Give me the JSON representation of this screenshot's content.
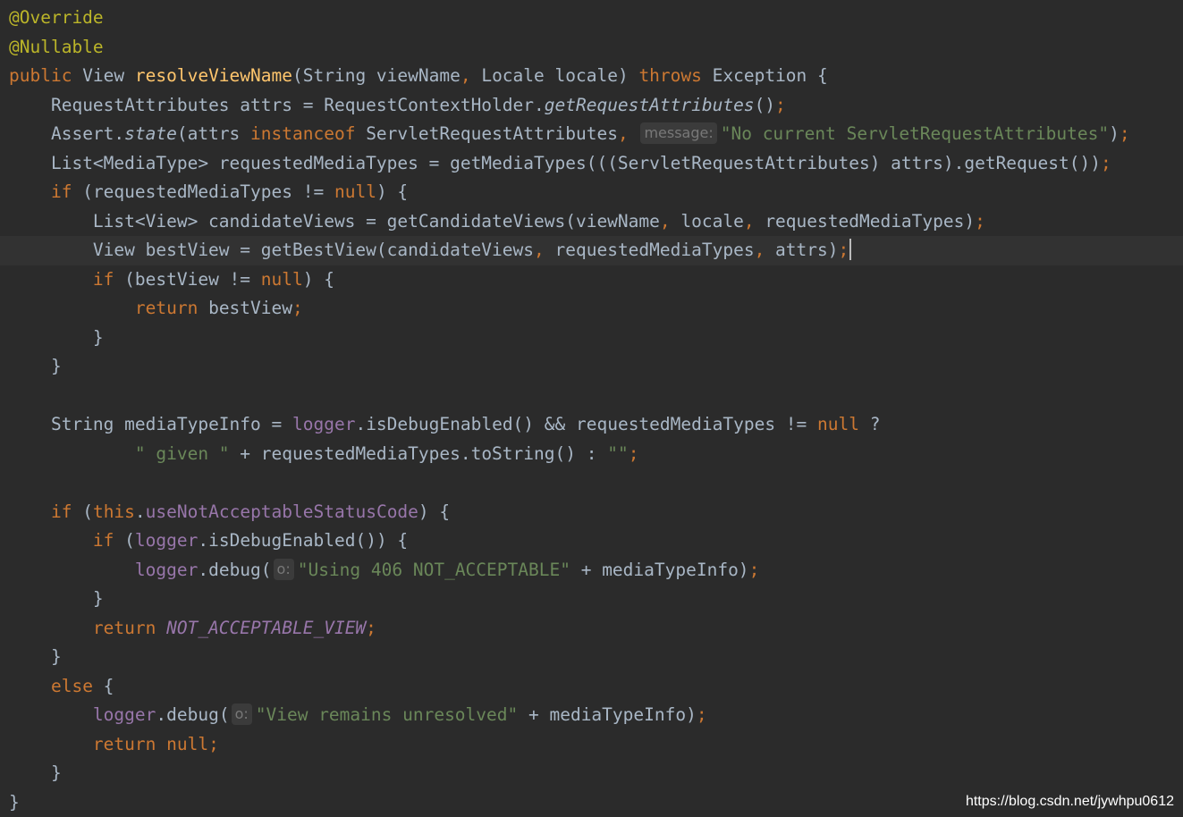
{
  "colors": {
    "background": "#2b2b2b",
    "current_line": "#323232",
    "keyword": "#cc7832",
    "annotation": "#bbb529",
    "method_declaration": "#ffc66d",
    "plain": "#a9b7c6",
    "string": "#6a8759",
    "field": "#9876aa",
    "hint": "#787878"
  },
  "code_lines": [
    {
      "indent": "",
      "tokens": [
        {
          "t": "@Override",
          "k": "annotation"
        }
      ]
    },
    {
      "indent": "",
      "tokens": [
        {
          "t": "@Nullable",
          "k": "annotation"
        }
      ]
    },
    {
      "indent": "",
      "tokens": [
        {
          "t": "public ",
          "k": "keyword"
        },
        {
          "t": "View ",
          "k": "plain"
        },
        {
          "t": "resolveViewName",
          "k": "method-decl"
        },
        {
          "t": "(String viewName",
          "k": "plain"
        },
        {
          "t": ", ",
          "k": "punct"
        },
        {
          "t": "Locale locale) ",
          "k": "plain"
        },
        {
          "t": "throws ",
          "k": "keyword"
        },
        {
          "t": "Exception {",
          "k": "plain"
        }
      ]
    },
    {
      "indent": "    ",
      "tokens": [
        {
          "t": "RequestAttributes attrs = RequestContextHolder.",
          "k": "plain"
        },
        {
          "t": "getRequestAttributes",
          "k": "static-call"
        },
        {
          "t": "()",
          "k": "plain"
        },
        {
          "t": ";",
          "k": "punct"
        }
      ]
    },
    {
      "indent": "    ",
      "tokens": [
        {
          "t": "Assert.",
          "k": "plain"
        },
        {
          "t": "state",
          "k": "static-call"
        },
        {
          "t": "(attrs ",
          "k": "plain"
        },
        {
          "t": "instanceof ",
          "k": "keyword"
        },
        {
          "t": "ServletRequestAttributes",
          "k": "plain"
        },
        {
          "t": ", ",
          "k": "punct"
        },
        {
          "t": "message:",
          "k": "hint"
        },
        {
          "t": "\"No current ServletRequestAttributes\"",
          "k": "string"
        },
        {
          "t": ")",
          "k": "plain"
        },
        {
          "t": ";",
          "k": "punct"
        }
      ]
    },
    {
      "indent": "    ",
      "tokens": [
        {
          "t": "List<MediaType> requestedMediaTypes = getMediaTypes(((ServletRequestAttributes) attrs).getRequest())",
          "k": "plain"
        },
        {
          "t": ";",
          "k": "punct"
        }
      ]
    },
    {
      "indent": "    ",
      "tokens": [
        {
          "t": "if ",
          "k": "keyword"
        },
        {
          "t": "(requestedMediaTypes != ",
          "k": "plain"
        },
        {
          "t": "null",
          "k": "keyword"
        },
        {
          "t": ") {",
          "k": "plain"
        }
      ]
    },
    {
      "indent": "        ",
      "tokens": [
        {
          "t": "List<View> candidateViews = getCandidateViews(viewName",
          "k": "plain"
        },
        {
          "t": ", ",
          "k": "punct"
        },
        {
          "t": "locale",
          "k": "plain"
        },
        {
          "t": ", ",
          "k": "punct"
        },
        {
          "t": "requestedMediaTypes)",
          "k": "plain"
        },
        {
          "t": ";",
          "k": "punct"
        }
      ]
    },
    {
      "indent": "        ",
      "current": true,
      "caret": true,
      "tokens": [
        {
          "t": "View bestView = getBestView(candidateViews",
          "k": "plain"
        },
        {
          "t": ", ",
          "k": "punct"
        },
        {
          "t": "requestedMediaTypes",
          "k": "plain"
        },
        {
          "t": ", ",
          "k": "punct"
        },
        {
          "t": "attrs)",
          "k": "plain"
        },
        {
          "t": ";",
          "k": "punct"
        }
      ]
    },
    {
      "indent": "        ",
      "tokens": [
        {
          "t": "if ",
          "k": "keyword"
        },
        {
          "t": "(bestView != ",
          "k": "plain"
        },
        {
          "t": "null",
          "k": "keyword"
        },
        {
          "t": ") {",
          "k": "plain"
        }
      ]
    },
    {
      "indent": "            ",
      "tokens": [
        {
          "t": "return ",
          "k": "keyword"
        },
        {
          "t": "bestView",
          "k": "plain"
        },
        {
          "t": ";",
          "k": "punct"
        }
      ]
    },
    {
      "indent": "        ",
      "tokens": [
        {
          "t": "}",
          "k": "plain"
        }
      ]
    },
    {
      "indent": "    ",
      "tokens": [
        {
          "t": "}",
          "k": "plain"
        }
      ]
    },
    {
      "indent": "",
      "tokens": []
    },
    {
      "indent": "    ",
      "tokens": [
        {
          "t": "String mediaTypeInfo = ",
          "k": "plain"
        },
        {
          "t": "logger",
          "k": "field"
        },
        {
          "t": ".isDebugEnabled() && requestedMediaTypes != ",
          "k": "plain"
        },
        {
          "t": "null ",
          "k": "keyword"
        },
        {
          "t": "?",
          "k": "plain"
        }
      ]
    },
    {
      "indent": "            ",
      "tokens": [
        {
          "t": "\" given \"",
          "k": "string"
        },
        {
          "t": " + requestedMediaTypes.toString() : ",
          "k": "plain"
        },
        {
          "t": "\"\"",
          "k": "string"
        },
        {
          "t": ";",
          "k": "punct"
        }
      ]
    },
    {
      "indent": "",
      "tokens": []
    },
    {
      "indent": "    ",
      "tokens": [
        {
          "t": "if ",
          "k": "keyword"
        },
        {
          "t": "(",
          "k": "plain"
        },
        {
          "t": "this",
          "k": "keyword"
        },
        {
          "t": ".",
          "k": "plain"
        },
        {
          "t": "useNotAcceptableStatusCode",
          "k": "field"
        },
        {
          "t": ") {",
          "k": "plain"
        }
      ]
    },
    {
      "indent": "        ",
      "tokens": [
        {
          "t": "if ",
          "k": "keyword"
        },
        {
          "t": "(",
          "k": "plain"
        },
        {
          "t": "logger",
          "k": "field"
        },
        {
          "t": ".isDebugEnabled()) {",
          "k": "plain"
        }
      ]
    },
    {
      "indent": "            ",
      "tokens": [
        {
          "t": "logger",
          "k": "field"
        },
        {
          "t": ".debug(",
          "k": "plain"
        },
        {
          "t": "o:",
          "k": "hint"
        },
        {
          "t": "\"Using 406 NOT_ACCEPTABLE\"",
          "k": "string"
        },
        {
          "t": " + mediaTypeInfo)",
          "k": "plain"
        },
        {
          "t": ";",
          "k": "punct"
        }
      ]
    },
    {
      "indent": "        ",
      "tokens": [
        {
          "t": "}",
          "k": "plain"
        }
      ]
    },
    {
      "indent": "        ",
      "tokens": [
        {
          "t": "return ",
          "k": "keyword"
        },
        {
          "t": "NOT_ACCEPTABLE_VIEW",
          "k": "const"
        },
        {
          "t": ";",
          "k": "punct"
        }
      ]
    },
    {
      "indent": "    ",
      "tokens": [
        {
          "t": "}",
          "k": "plain"
        }
      ]
    },
    {
      "indent": "    ",
      "tokens": [
        {
          "t": "else ",
          "k": "keyword"
        },
        {
          "t": "{",
          "k": "plain"
        }
      ]
    },
    {
      "indent": "        ",
      "tokens": [
        {
          "t": "logger",
          "k": "field"
        },
        {
          "t": ".debug(",
          "k": "plain"
        },
        {
          "t": "o:",
          "k": "hint"
        },
        {
          "t": "\"View remains unresolved\"",
          "k": "string"
        },
        {
          "t": " + mediaTypeInfo)",
          "k": "plain"
        },
        {
          "t": ";",
          "k": "punct"
        }
      ]
    },
    {
      "indent": "        ",
      "tokens": [
        {
          "t": "return ",
          "k": "keyword"
        },
        {
          "t": "null",
          "k": "keyword"
        },
        {
          "t": ";",
          "k": "punct"
        }
      ]
    },
    {
      "indent": "    ",
      "tokens": [
        {
          "t": "}",
          "k": "plain"
        }
      ]
    },
    {
      "indent": "",
      "tokens": [
        {
          "t": "}",
          "k": "plain"
        }
      ]
    }
  ],
  "watermark": "https://blog.csdn.net/jywhpu0612"
}
